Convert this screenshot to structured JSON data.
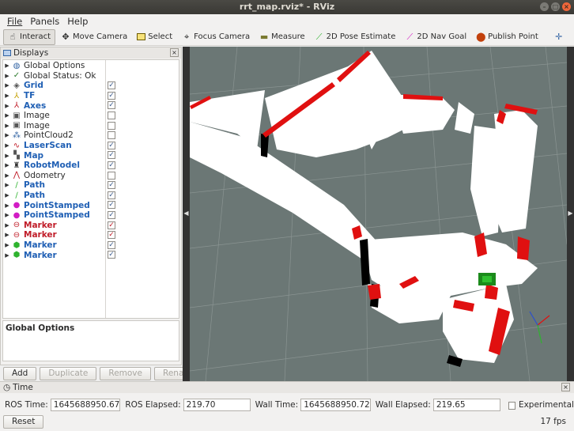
{
  "window": {
    "title": "rrt_map.rviz* - RViz"
  },
  "menu": [
    "File",
    "Panels",
    "Help"
  ],
  "toolbar": [
    {
      "label": "Interact",
      "icon": "interact-icon",
      "active": true
    },
    {
      "label": "Move Camera",
      "icon": "move-camera-icon"
    },
    {
      "label": "Select",
      "icon": "select-icon"
    },
    {
      "label": "Focus Camera",
      "icon": "focus-camera-icon"
    },
    {
      "label": "Measure",
      "icon": "measure-icon"
    },
    {
      "label": "2D Pose Estimate",
      "icon": "pose-estimate-icon"
    },
    {
      "label": "2D Nav Goal",
      "icon": "nav-goal-icon"
    },
    {
      "label": "Publish Point",
      "icon": "publish-point-icon"
    }
  ],
  "displays": {
    "title": "Displays",
    "items": [
      {
        "label": "Global Options",
        "icon": "globe-icon",
        "style": "normal",
        "checkbox": null
      },
      {
        "label": "Global Status: Ok",
        "icon": "check-icon",
        "style": "normal",
        "checkbox": null
      },
      {
        "label": "Grid",
        "icon": "grid-icon",
        "style": "blue",
        "checkbox": true
      },
      {
        "label": "TF",
        "icon": "tf-icon",
        "style": "blue",
        "checkbox": true
      },
      {
        "label": "Axes",
        "icon": "axes-icon",
        "style": "blue",
        "checkbox": true
      },
      {
        "label": "Image",
        "icon": "image-icon",
        "style": "normal",
        "checkbox": false
      },
      {
        "label": "Image",
        "icon": "image-icon",
        "style": "normal",
        "checkbox": false
      },
      {
        "label": "PointCloud2",
        "icon": "pointcloud-icon",
        "style": "normal",
        "checkbox": false
      },
      {
        "label": "LaserScan",
        "icon": "laserscan-icon",
        "style": "blue",
        "checkbox": true
      },
      {
        "label": "Map",
        "icon": "map-icon",
        "style": "blue",
        "checkbox": true
      },
      {
        "label": "RobotModel",
        "icon": "robot-icon",
        "style": "blue",
        "checkbox": true
      },
      {
        "label": "Odometry",
        "icon": "odometry-icon",
        "style": "normal",
        "checkbox": false
      },
      {
        "label": "Path",
        "icon": "path-icon",
        "style": "blue",
        "checkbox": true
      },
      {
        "label": "Path",
        "icon": "path-icon",
        "style": "blue",
        "checkbox": true
      },
      {
        "label": "PointStamped",
        "icon": "point-icon",
        "style": "blue",
        "checkbox": true
      },
      {
        "label": "PointStamped",
        "icon": "point-icon",
        "style": "blue",
        "checkbox": true
      },
      {
        "label": "Marker",
        "icon": "marker-icon",
        "style": "red",
        "checkbox": true
      },
      {
        "label": "Marker",
        "icon": "marker-icon",
        "style": "red",
        "checkbox": true
      },
      {
        "label": "Marker",
        "icon": "marker-green-icon",
        "style": "blue",
        "checkbox": true
      },
      {
        "label": "Marker",
        "icon": "marker-green-icon",
        "style": "blue",
        "checkbox": true
      }
    ],
    "description_title": "Global Options",
    "buttons": [
      {
        "label": "Add",
        "enabled": true
      },
      {
        "label": "Duplicate",
        "enabled": false
      },
      {
        "label": "Remove",
        "enabled": false
      },
      {
        "label": "Rename",
        "enabled": false
      }
    ]
  },
  "time": {
    "title": "Time",
    "ros_time_label": "ROS Time:",
    "ros_time": "1645688950.67",
    "ros_elapsed_label": "ROS Elapsed:",
    "ros_elapsed": "219.70",
    "wall_time_label": "Wall Time:",
    "wall_time": "1645688950.72",
    "wall_elapsed_label": "Wall Elapsed:",
    "wall_elapsed": "219.65",
    "experimental_label": "Experimental",
    "experimental": false,
    "reset_label": "Reset",
    "fps": "17 fps"
  },
  "colors": {
    "viewport_bg": "#6b7775",
    "map_free": "#ffffff",
    "laser": "#e01010",
    "robot": "#1b8a1b"
  }
}
